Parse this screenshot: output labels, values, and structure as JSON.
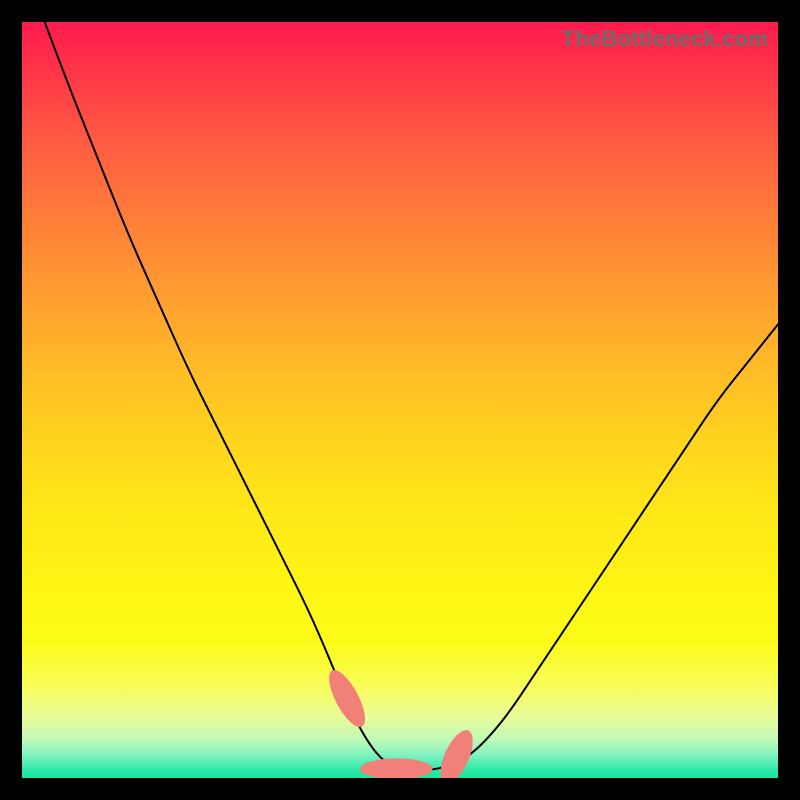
{
  "watermark": {
    "text": "TheBottleneck.com",
    "font_size_px": 22
  },
  "gradient": {
    "top_color": "#ff1a4f",
    "mid_color": "#ffe818",
    "bottom_color": "#18e69e"
  },
  "chart_data": {
    "type": "line",
    "title": "",
    "xlabel": "",
    "ylabel": "",
    "xlim": [
      0,
      100
    ],
    "ylim": [
      0,
      100
    ],
    "grid": false,
    "legend": false,
    "series": [
      {
        "name": "bottleneck-curve",
        "x": [
          3,
          6,
          10,
          14,
          18,
          22,
          26,
          30,
          34,
          38,
          41,
          43,
          45,
          47,
          49,
          51,
          53,
          55,
          57,
          60,
          64,
          68,
          72,
          76,
          80,
          84,
          88,
          92,
          96,
          100
        ],
        "y": [
          100,
          92,
          82,
          72,
          63,
          54,
          46,
          38,
          30,
          22,
          15,
          10,
          6,
          3,
          1.5,
          1,
          1,
          1.2,
          1.8,
          3.5,
          8,
          14,
          20,
          26,
          32,
          38,
          44,
          50,
          55,
          60
        ],
        "stroke": "#000000",
        "stroke_width": 2
      }
    ],
    "markers": [
      {
        "shape": "pill",
        "cx": 43.0,
        "cy": 10.5,
        "rx": 1.5,
        "ry": 4.2,
        "angle": -28,
        "fill": "#f08078"
      },
      {
        "shape": "pill",
        "cx": 49.5,
        "cy": 1.2,
        "rx": 4.8,
        "ry": 1.4,
        "angle": 0,
        "fill": "#f08078"
      },
      {
        "shape": "pill",
        "cx": 57.5,
        "cy": 2.8,
        "rx": 1.6,
        "ry": 3.8,
        "angle": 24,
        "fill": "#f08078"
      }
    ]
  }
}
